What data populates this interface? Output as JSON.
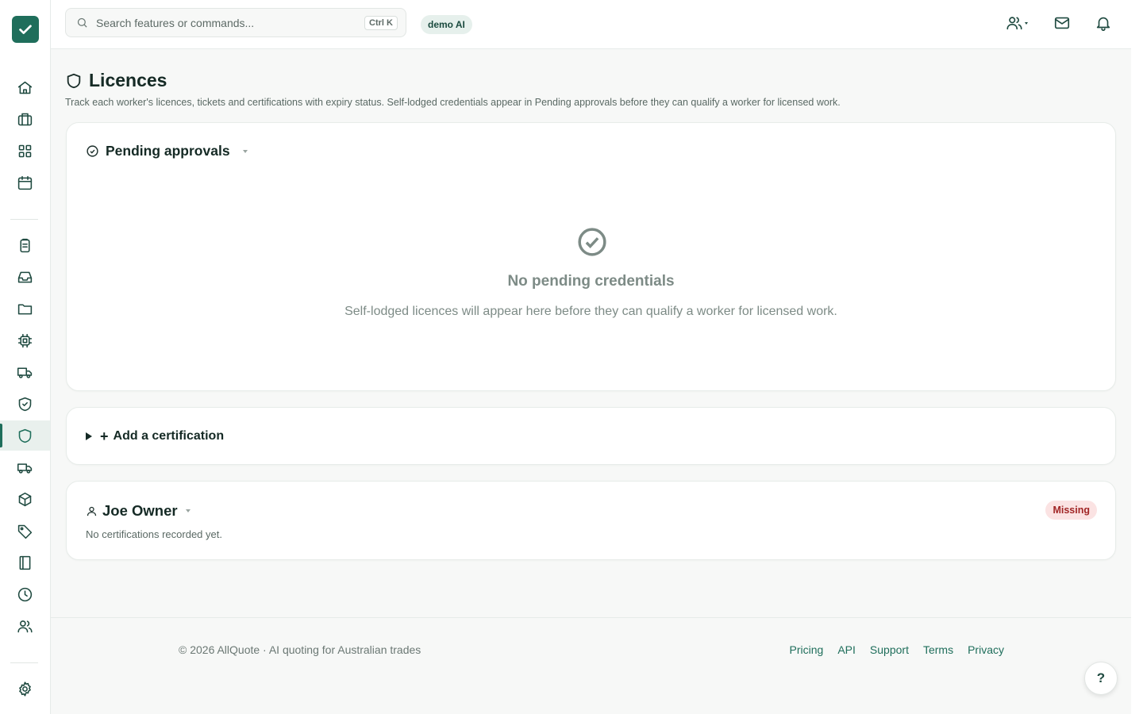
{
  "app": {
    "brand_color": "#1f6e5b",
    "logo_icon": "check-icon"
  },
  "sidebar": {
    "items": [
      {
        "name": "home",
        "icon": "home-icon"
      },
      {
        "name": "jobs",
        "icon": "briefcase-icon"
      },
      {
        "name": "apps",
        "icon": "grid-icon"
      },
      {
        "name": "calendar",
        "icon": "calendar-icon"
      },
      {
        "name": "quotes",
        "icon": "clipboard-icon"
      },
      {
        "name": "inbox",
        "icon": "inbox-icon"
      },
      {
        "name": "files",
        "icon": "folder-icon"
      },
      {
        "name": "ai",
        "icon": "chip-icon"
      },
      {
        "name": "deliveries",
        "icon": "truck-icon"
      },
      {
        "name": "compliance",
        "icon": "shield-check-icon"
      },
      {
        "name": "licences",
        "icon": "shield-icon",
        "active": true
      },
      {
        "name": "fleet",
        "icon": "van-icon"
      },
      {
        "name": "inventory",
        "icon": "box-icon"
      },
      {
        "name": "pricing",
        "icon": "tag-icon"
      },
      {
        "name": "ledger",
        "icon": "book-icon"
      },
      {
        "name": "timesheets",
        "icon": "clock-icon"
      },
      {
        "name": "team",
        "icon": "users-icon"
      },
      {
        "name": "settings",
        "icon": "gear-icon"
      }
    ]
  },
  "topbar": {
    "search_placeholder": "Search features or commands...",
    "shortcut": "Ctrl K",
    "org_badge": "demo AI"
  },
  "page": {
    "title": "Licences",
    "subtitle": "Track each worker's licences, tickets and certifications with expiry status. Self-lodged credentials appear in Pending approvals before they can qualify a worker for licensed work."
  },
  "pending": {
    "title": "Pending approvals",
    "empty_title": "No pending credentials",
    "empty_desc": "Self-lodged licences will appear here before they can qualify a worker for licensed work."
  },
  "add_cert": {
    "plus": "+",
    "label": "Add a certification"
  },
  "worker": {
    "name": "Joe Owner",
    "note": "No certifications recorded yet.",
    "status": "Missing"
  },
  "footer": {
    "copyright": "© 2026 AllQuote · AI quoting for Australian trades",
    "links": [
      "Pricing",
      "API",
      "Support",
      "Terms",
      "Privacy"
    ],
    "help": "?"
  }
}
